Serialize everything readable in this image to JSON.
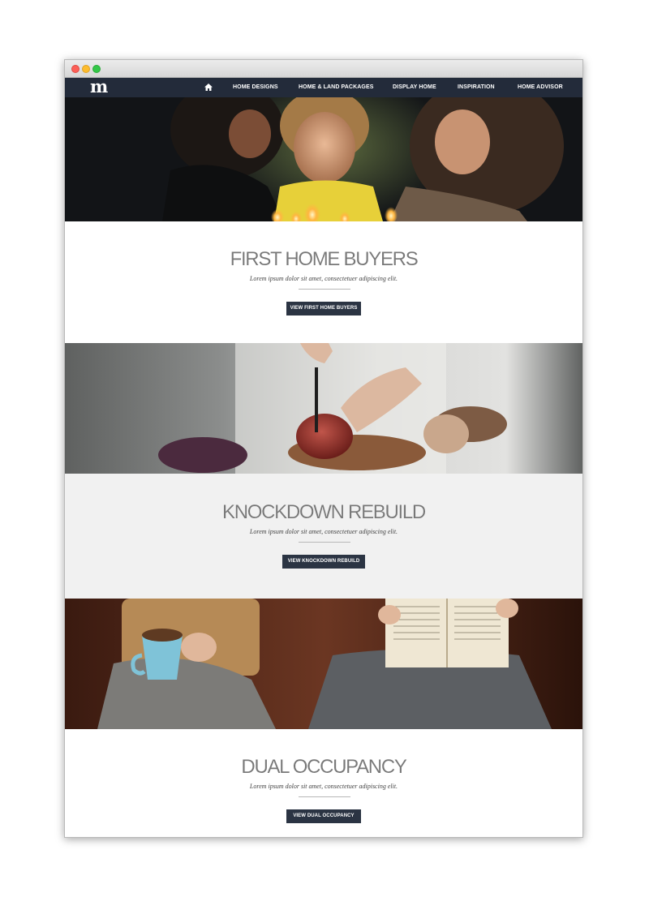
{
  "nav": {
    "logo": "m",
    "items": [
      {
        "label": "HOME DESIGNS"
      },
      {
        "label": "HOME & LAND PACKAGES"
      },
      {
        "label": "DISPLAY HOME"
      },
      {
        "label": "INSPIRATION"
      },
      {
        "label": "HOME ADVISOR"
      }
    ]
  },
  "sections": [
    {
      "title": "FIRST HOME BUYERS",
      "subtitle": "Lorem ipsum dolor sit amet, consectetuer adipiscing elit.",
      "button": "VIEW FIRST HOME BUYERS",
      "image": "family-birthday-candles-photo"
    },
    {
      "title": "KNOCKDOWN REBUILD",
      "subtitle": "Lorem ipsum dolor sit amet, consectetuer adipiscing elit.",
      "button": "VIEW KNOCKDOWN REBUILD",
      "image": "cutting-onion-photo"
    },
    {
      "title": "DUAL OCCUPANCY",
      "subtitle": "Lorem ipsum dolor sit amet, consectetuer adipiscing elit.",
      "button": "VIEW DUAL OCCUPANCY",
      "image": "couple-reading-coffee-photo"
    }
  ],
  "colors": {
    "navbar": "#232b3a",
    "button": "#2b3443",
    "section_alt_bg": "#f1f1f1"
  }
}
